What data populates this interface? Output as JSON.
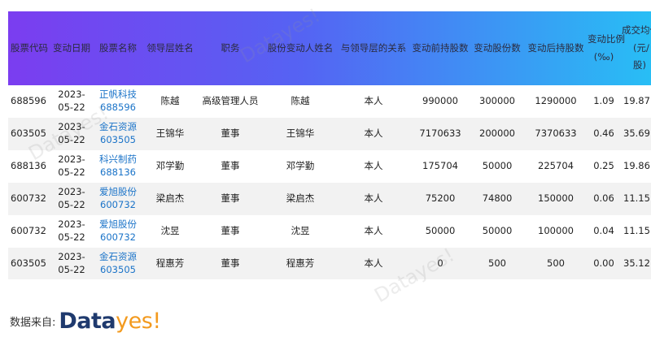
{
  "headers": {
    "code": "股票代码",
    "date": "变动日期",
    "name": "股票名称",
    "leader": "领导层姓名",
    "position": "职务",
    "changer": "股份变动人姓名",
    "relation": "与领导层的关系",
    "before": "变动前持股数",
    "change": "变动股份数",
    "after": "变动后持股数",
    "ratio_line1": "变动比例",
    "ratio_line2": "(‰)",
    "price_line1": "成交均价",
    "price_line2": "(元/",
    "price_line3": "股)"
  },
  "rows": [
    {
      "code": "688596",
      "date1": "2023-",
      "date2": "05-22",
      "name": "正帆科技",
      "name_code": "688596",
      "leader": "陈越",
      "position": "高级管理人员",
      "changer": "陈越",
      "relation": "本人",
      "before": "990000",
      "change": "300000",
      "after": "1290000",
      "ratio": "1.09",
      "price": "19.87"
    },
    {
      "code": "603505",
      "date1": "2023-",
      "date2": "05-22",
      "name": "金石资源",
      "name_code": "603505",
      "leader": "王锦华",
      "position": "董事",
      "changer": "王锦华",
      "relation": "本人",
      "before": "7170633",
      "change": "200000",
      "after": "7370633",
      "ratio": "0.46",
      "price": "35.69"
    },
    {
      "code": "688136",
      "date1": "2023-",
      "date2": "05-22",
      "name": "科兴制药",
      "name_code": "688136",
      "leader": "邓学勤",
      "position": "董事",
      "changer": "邓学勤",
      "relation": "本人",
      "before": "175704",
      "change": "50000",
      "after": "225704",
      "ratio": "0.25",
      "price": "19.86"
    },
    {
      "code": "600732",
      "date1": "2023-",
      "date2": "05-22",
      "name": "爱旭股份",
      "name_code": "600732",
      "leader": "梁启杰",
      "position": "董事",
      "changer": "梁启杰",
      "relation": "本人",
      "before": "75200",
      "change": "74800",
      "after": "150000",
      "ratio": "0.06",
      "price": "11.15"
    },
    {
      "code": "600732",
      "date1": "2023-",
      "date2": "05-22",
      "name": "爱旭股份",
      "name_code": "600732",
      "leader": "沈昱",
      "position": "董事",
      "changer": "沈昱",
      "relation": "本人",
      "before": "50000",
      "change": "50000",
      "after": "100000",
      "ratio": "0.04",
      "price": "11.15"
    },
    {
      "code": "603505",
      "date1": "2023-",
      "date2": "05-22",
      "name": "金石资源",
      "name_code": "603505",
      "leader": "程惠芳",
      "position": "董事",
      "changer": "程惠芳",
      "relation": "本人",
      "before": "0",
      "change": "500",
      "after": "500",
      "ratio": "0.00",
      "price": "35.12"
    }
  ],
  "source": {
    "label": "数据来自:",
    "logo_part1": "Data",
    "logo_part2": "yes!",
    "logo_dark_color": "#1f3a6e",
    "logo_orange_color": "#f39a1e"
  },
  "watermark": "Datayes!",
  "colors": {
    "header_gradient_start": "#7b3df0",
    "header_gradient_end": "#27c0f5",
    "link": "#1a73c8",
    "stripe": "#f2f2f2"
  }
}
